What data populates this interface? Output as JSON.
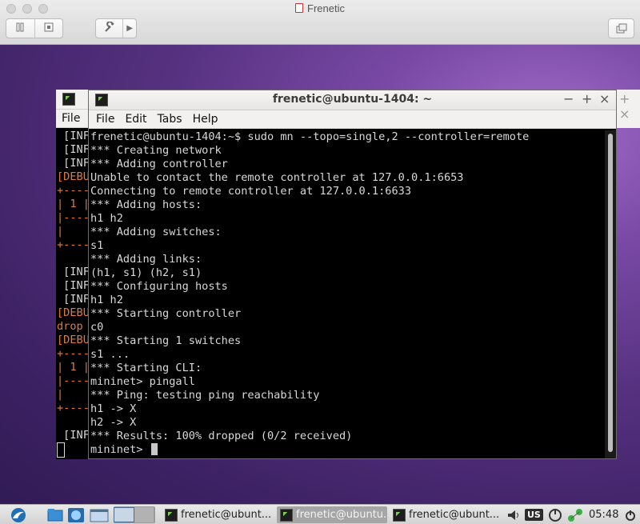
{
  "vm": {
    "title": "Frenetic",
    "pause_icon": "pause-icon",
    "snapshot_icon": "snapshot-icon",
    "settings_icon": "wrench-icon",
    "forward_icon": "play-forward-icon",
    "window_icon": "restore-windows-icon"
  },
  "terminal": {
    "title": "frenetic@ubuntu-1404: ~",
    "window_controls": {
      "close": "×",
      "minimize": "−",
      "maximize": "+"
    },
    "menu": [
      "File",
      "Edit",
      "Tabs",
      "Help"
    ],
    "lines": [
      "frenetic@ubuntu-1404:~$ sudo mn --topo=single,2 --controller=remote",
      "*** Creating network",
      "*** Adding controller",
      "Unable to contact the remote controller at 127.0.0.1:6653",
      "Connecting to remote controller at 127.0.0.1:6633",
      "*** Adding hosts:",
      "h1 h2",
      "*** Adding switches:",
      "s1",
      "*** Adding links:",
      "(h1, s1) (h2, s1)",
      "*** Configuring hosts",
      "h1 h2",
      "*** Starting controller",
      "c0",
      "*** Starting 1 switches",
      "s1 ...",
      "*** Starting CLI:",
      "mininet> pingall",
      "*** Ping: testing ping reachability",
      "h1 -> X",
      "h2 -> X",
      "*** Results: 100% dropped (0/2 received)"
    ],
    "prompt": "mininet> "
  },
  "back_terminal": {
    "menu": "File",
    "lines": [
      {
        "text": " [INF",
        "kind": "info"
      },
      {
        "text": " [INF",
        "kind": "info"
      },
      {
        "text": " [INF",
        "kind": "info"
      },
      {
        "text": "[DEBU",
        "kind": "debu"
      },
      {
        "text": "+----",
        "kind": "debu"
      },
      {
        "text": "| 1 |",
        "kind": "debu"
      },
      {
        "text": "|----",
        "kind": "debu"
      },
      {
        "text": "|    ",
        "kind": "debu"
      },
      {
        "text": "+----",
        "kind": "debu"
      },
      {
        "text": "",
        "kind": "info"
      },
      {
        "text": " [INF",
        "kind": "info"
      },
      {
        "text": " [INF",
        "kind": "info"
      },
      {
        "text": " [INF",
        "kind": "info"
      },
      {
        "text": "[DEBU",
        "kind": "debu"
      },
      {
        "text": "drop ",
        "kind": "debu"
      },
      {
        "text": "[DEBU",
        "kind": "debu"
      },
      {
        "text": "+----",
        "kind": "debu"
      },
      {
        "text": "| 1 |",
        "kind": "debu"
      },
      {
        "text": "|----",
        "kind": "debu"
      },
      {
        "text": "|    ",
        "kind": "debu"
      },
      {
        "text": "+----",
        "kind": "debu"
      },
      {
        "text": "",
        "kind": "info"
      },
      {
        "text": " [INF",
        "kind": "info"
      }
    ]
  },
  "right_window": {
    "controls": "+ ×"
  },
  "taskbar": {
    "tasks": [
      {
        "label": "frenetic@ubunt...",
        "active": false
      },
      {
        "label": "frenetic@ubuntu...",
        "active": true
      },
      {
        "label": "frenetic@ubunt...",
        "active": false
      }
    ],
    "keyboard_layout": "US",
    "clock": "05:48"
  }
}
